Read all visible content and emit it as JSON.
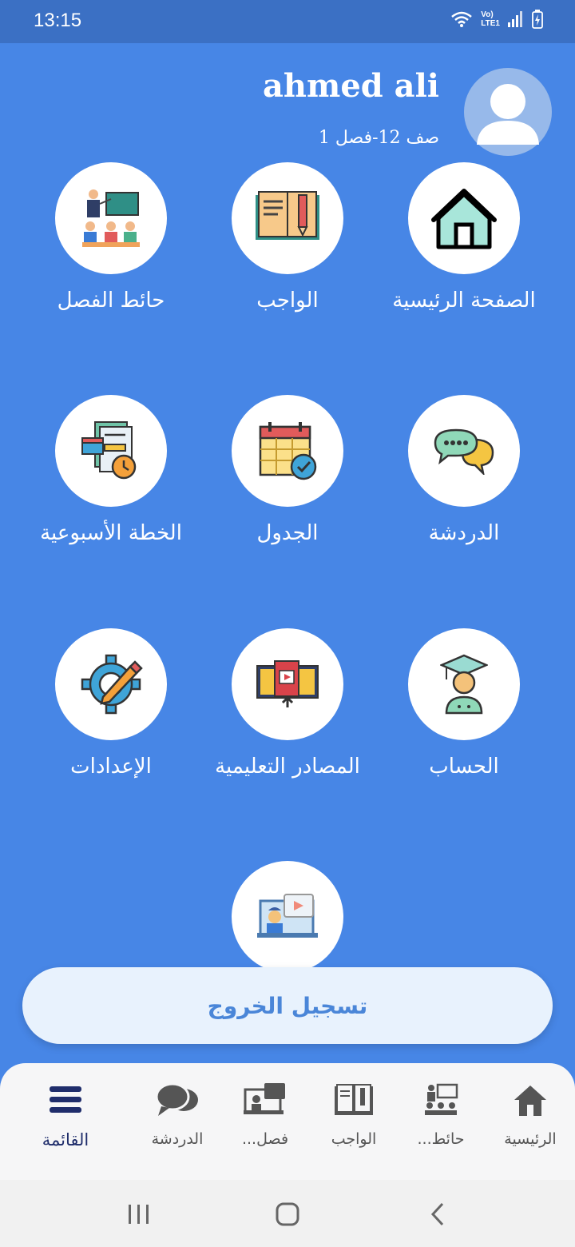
{
  "status_bar": {
    "time": "13:15",
    "network_label_1": "Vo)",
    "network_label_2": "LTE1"
  },
  "profile": {
    "name": "ahmed ali",
    "class_info": "صف 12-فصل 1"
  },
  "grid": [
    {
      "label": "الصفحة الرئيسية",
      "icon": "house-icon"
    },
    {
      "label": "الواجب",
      "icon": "homework-book-icon"
    },
    {
      "label": "حائط الفصل",
      "icon": "classroom-icon"
    },
    {
      "label": "الدردشة",
      "icon": "chat-bubbles-icon"
    },
    {
      "label": "الجدول",
      "icon": "calendar-icon"
    },
    {
      "label": "الخطة الأسبوعية",
      "icon": "weekly-plan-icon"
    },
    {
      "label": "الحساب",
      "icon": "graduate-icon"
    },
    {
      "label": "المصادر التعليمية",
      "icon": "learning-resources-icon"
    },
    {
      "label": "الإعدادات",
      "icon": "settings-gear-icon"
    },
    {
      "label": "",
      "icon": "video-class-icon"
    }
  ],
  "logout_label": "تسجيل الخروج",
  "bottom_nav": [
    {
      "label": "الرئيسية",
      "icon": "home-icon"
    },
    {
      "label": "حائط...",
      "icon": "classroom-icon"
    },
    {
      "label": "الواجب",
      "icon": "book-icon"
    },
    {
      "label": "فصل...",
      "icon": "video-class-icon"
    },
    {
      "label": "الدردشة",
      "icon": "chat-icon"
    },
    {
      "label": "القائمة",
      "icon": "menu-icon"
    }
  ],
  "colors": {
    "background": "#4786e6",
    "status_bar": "#3b70c4",
    "active_nav": "#1f2d6b",
    "logout_text": "#4a86d8"
  }
}
